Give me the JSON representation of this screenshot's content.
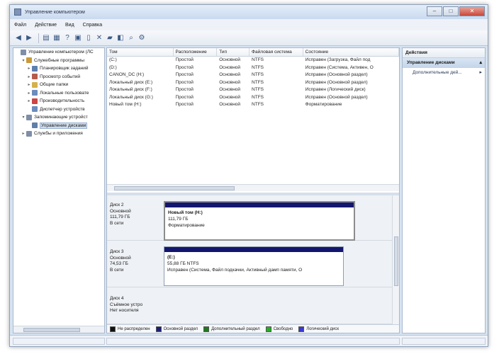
{
  "window": {
    "title": "Управление компьютером"
  },
  "menu": [
    "Файл",
    "Действие",
    "Вид",
    "Справка"
  ],
  "toolbar_icons": [
    "back-icon",
    "forward-icon",
    "folder-icon",
    "console-tree-icon",
    "help-icon",
    "properties-icon",
    "document-icon",
    "delete-icon",
    "connect-icon",
    "rescan-icon",
    "search-icon",
    "settings-icon"
  ],
  "tree": [
    {
      "label": "Управление компьютером (ЛС",
      "indent": 0,
      "exp": "",
      "color": "#7f8ea8"
    },
    {
      "label": "Служебные программы",
      "indent": 1,
      "exp": "▾",
      "color": "#c99a3a"
    },
    {
      "label": "Планировщик заданий",
      "indent": 2,
      "exp": "▸",
      "color": "#5d7fb0"
    },
    {
      "label": "Просмотр событий",
      "indent": 2,
      "exp": "▸",
      "color": "#b65b4c"
    },
    {
      "label": "Общие папки",
      "indent": 2,
      "exp": "▸",
      "color": "#d6b14a"
    },
    {
      "label": "Локальные пользовате",
      "indent": 2,
      "exp": "▸",
      "color": "#6b8cbc"
    },
    {
      "label": "Производительность",
      "indent": 2,
      "exp": "▸",
      "color": "#c44"
    },
    {
      "label": "Диспетчер устройств",
      "indent": 2,
      "exp": "",
      "color": "#6b8cbc"
    },
    {
      "label": "Запоминающие устройст",
      "indent": 1,
      "exp": "▾",
      "color": "#7f8ea8"
    },
    {
      "label": "Управление дисками",
      "indent": 2,
      "exp": "",
      "color": "#5f7fa8",
      "selected": true
    },
    {
      "label": "Службы и приложения",
      "indent": 1,
      "exp": "▸",
      "color": "#7f8ea8"
    }
  ],
  "volumes": {
    "headers": [
      "Том",
      "Расположение",
      "Тип",
      "Файловая система",
      "Состояние"
    ],
    "rows": [
      [
        "(C:)",
        "Простой",
        "Основной",
        "NTFS",
        "Исправен (Загрузка, Файл под"
      ],
      [
        "(D:)",
        "Простой",
        "Основной",
        "NTFS",
        "Исправен (Система, Активен, О"
      ],
      [
        "CANON_DC (H:)",
        "Простой",
        "Основной",
        "NTFS",
        "Исправен (Основной раздел)"
      ],
      [
        "Локальный диск (E:)",
        "Простой",
        "Основной",
        "NTFS",
        "Исправен (Основной раздел)"
      ],
      [
        "Локальный диск (F:)",
        "Простой",
        "Основной",
        "NTFS",
        "Исправен (Логический диск)"
      ],
      [
        "Локальный диск (G:)",
        "Простой",
        "Основной",
        "NTFS",
        "Исправен (Основной раздел)"
      ],
      [
        "Новый том (H:)",
        "Простой",
        "Основной",
        "NTFS",
        "Форматирование"
      ]
    ]
  },
  "disks": [
    {
      "name": "Диск 2",
      "type": "Основной",
      "size": "111,79 ГБ",
      "status": "В сети",
      "part": {
        "name": "Новый том (H:)",
        "size": "111,79 ГБ",
        "state": "Форматирование"
      }
    },
    {
      "name": "Диск 3",
      "type": "Основной",
      "size": "74,53 ГБ",
      "status": "В сети",
      "part": {
        "name": "(E:)",
        "size": "55,88 ГБ NTFS",
        "state": "Исправен (Система, Файл подкачки, Активный дамп памяти, О"
      }
    },
    {
      "name": "Диск 4",
      "type": "Съёмное устро",
      "size": "",
      "status": "Нет носителя"
    }
  ],
  "legend": [
    {
      "label": "Не распределен",
      "color": "#111111"
    },
    {
      "label": "Основной раздел",
      "color": "#1a1f7a"
    },
    {
      "label": "Дополнительный раздел",
      "color": "#1d7a1d"
    },
    {
      "label": "Свободно",
      "color": "#22b022"
    },
    {
      "label": "Логический диск",
      "color": "#3a3ad0"
    }
  ],
  "actions": {
    "header": "Действия",
    "group": "Управление дисками",
    "item": "Дополнительные дей..."
  }
}
